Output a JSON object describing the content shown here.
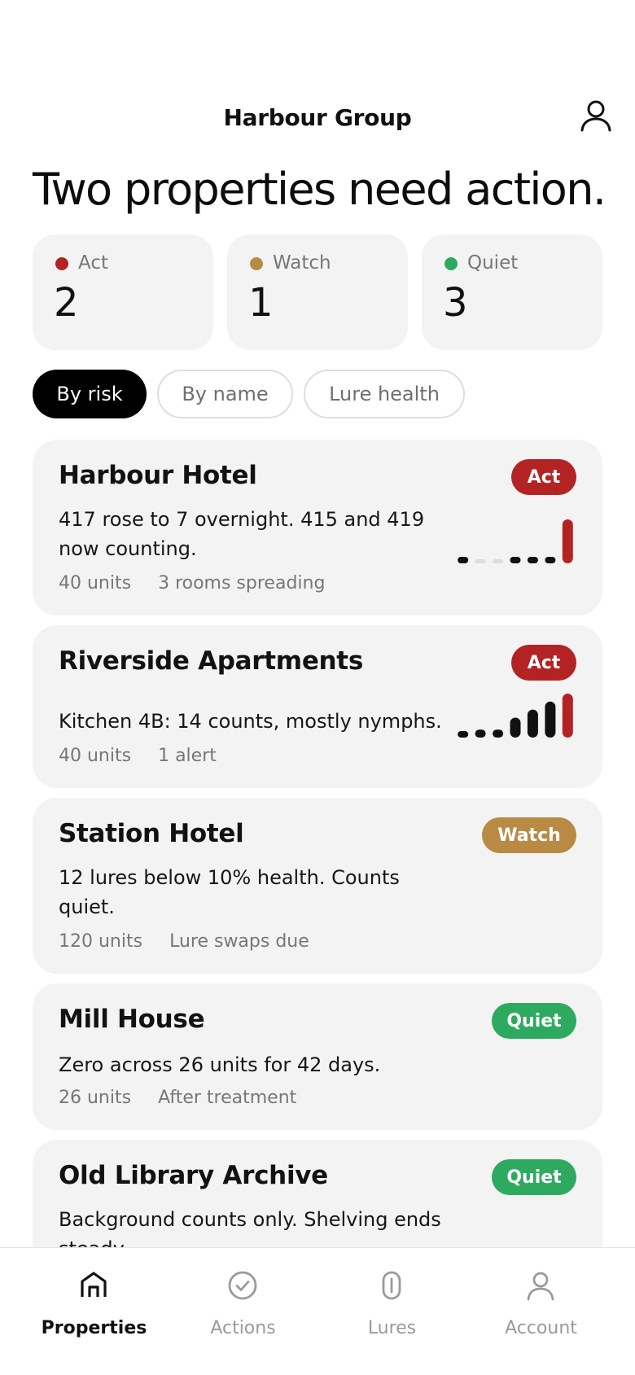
{
  "header": {
    "title": "Harbour Group",
    "avatar_icon": "user-icon"
  },
  "headline": "Two properties need action.",
  "summary": [
    {
      "label": "Act",
      "value": "2",
      "color": "#b42323"
    },
    {
      "label": "Watch",
      "value": "1",
      "color": "#b98a44"
    },
    {
      "label": "Quiet",
      "value": "3",
      "color": "#2eaa60"
    }
  ],
  "filters": [
    {
      "label": "By risk",
      "selected": true
    },
    {
      "label": "By name",
      "selected": false
    },
    {
      "label": "Lure health",
      "selected": false
    }
  ],
  "colors": {
    "act": "#b42323",
    "watch": "#b98a44",
    "quiet": "#2eaa60",
    "empty": "#dddddd"
  },
  "properties": [
    {
      "name": "Harbour Hotel",
      "status": "Act",
      "description": "417 rose to 7 overnight. 415 and 419 now counting.",
      "units": "40 units",
      "detail": "3 rooms spreading",
      "trend": [
        1,
        0,
        0,
        0.3,
        0.3,
        1,
        7
      ]
    },
    {
      "name": "Riverside Apartments",
      "status": "Act",
      "description": "Kitchen 4B: 14 counts, mostly nymphs.",
      "units": "40 units",
      "detail": "1 alert",
      "trend": [
        1,
        2,
        2,
        5,
        7,
        9,
        11
      ]
    },
    {
      "name": "Station Hotel",
      "status": "Watch",
      "description": "12 lures below 10% health. Counts quiet.",
      "units": "120 units",
      "detail": "Lure swaps due"
    },
    {
      "name": "Mill House",
      "status": "Quiet",
      "description": "Zero across 26 units for 42 days.",
      "units": "26 units",
      "detail": "After treatment"
    },
    {
      "name": "Old Library Archive",
      "status": "Quiet",
      "description": "Background counts only. Shelving ends steady."
    }
  ],
  "nav": [
    {
      "label": "Properties",
      "icon": "home-icon",
      "active": true
    },
    {
      "label": "Actions",
      "icon": "check-circle-icon",
      "active": false
    },
    {
      "label": "Lures",
      "icon": "lure-icon",
      "active": false
    },
    {
      "label": "Account",
      "icon": "account-icon",
      "active": false
    }
  ]
}
